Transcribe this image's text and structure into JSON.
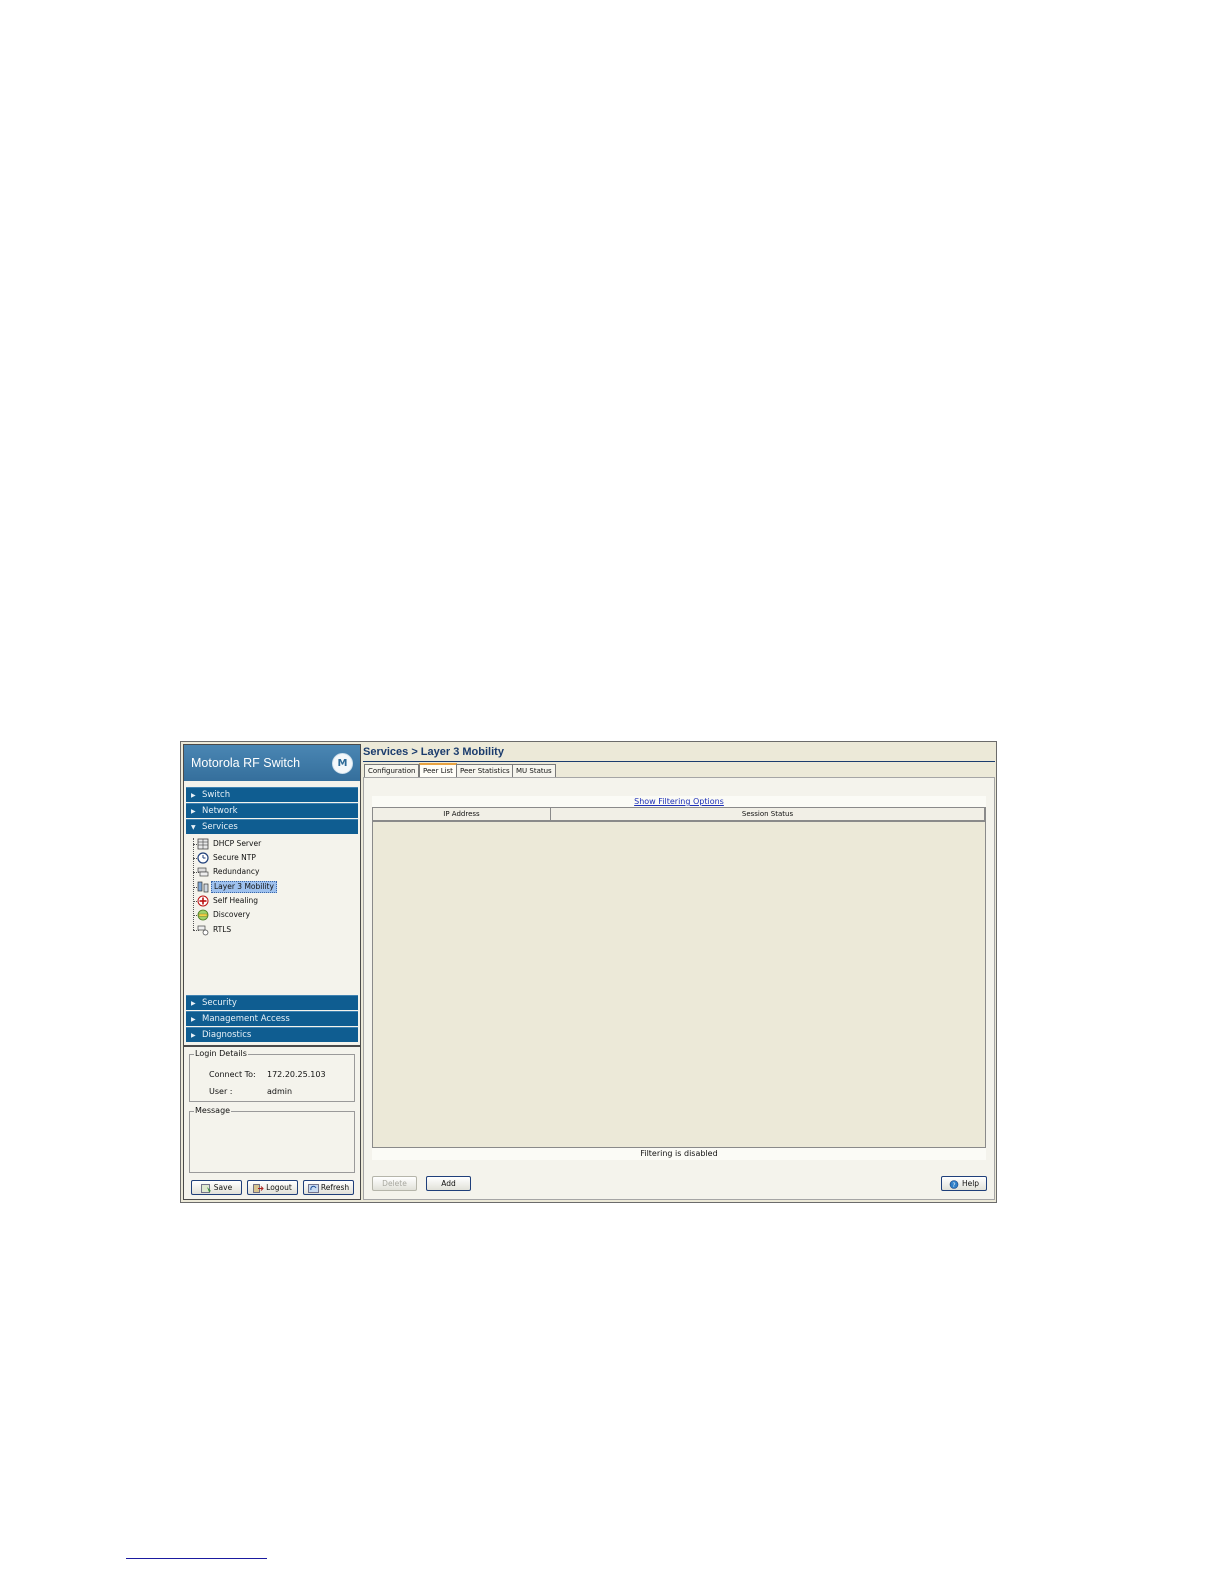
{
  "app": {
    "brand_title": "Motorola RF Switch",
    "logo_glyph": "M"
  },
  "nav": {
    "top_sections": [
      "Switch",
      "Network",
      "Services"
    ],
    "bottom_sections": [
      "Security",
      "Management Access",
      "Diagnostics"
    ]
  },
  "tree": {
    "items": [
      "DHCP Server",
      "Secure NTP",
      "Redundancy",
      "Layer 3 Mobility",
      "Self Healing",
      "Discovery",
      "RTLS"
    ],
    "selected": "Layer 3 Mobility"
  },
  "login": {
    "legend": "Login Details",
    "connect_label": "Connect To:",
    "connect_value": "172.20.25.103",
    "user_label": "User :",
    "user_value": "admin"
  },
  "message": {
    "legend": "Message"
  },
  "left_buttons": {
    "save": "Save",
    "logout": "Logout",
    "refresh": "Refresh"
  },
  "page": {
    "title": "Services > Layer 3 Mobility",
    "tabs": [
      "Configuration",
      "Peer List",
      "Peer Statistics",
      "MU Status"
    ],
    "active_tab": "Peer List"
  },
  "peer_list": {
    "filter_link": "Show Filtering Options",
    "columns": [
      "IP Address",
      "Session Status"
    ],
    "rows": [],
    "filter_status": "Filtering is disabled"
  },
  "actions": {
    "delete": "Delete",
    "add": "Add",
    "help": "Help"
  },
  "colors": {
    "nav_bg": "#0f5d91",
    "brand_bg": "#4a86b3",
    "selection": "#9ec1ee",
    "link": "#1d2fb8"
  }
}
